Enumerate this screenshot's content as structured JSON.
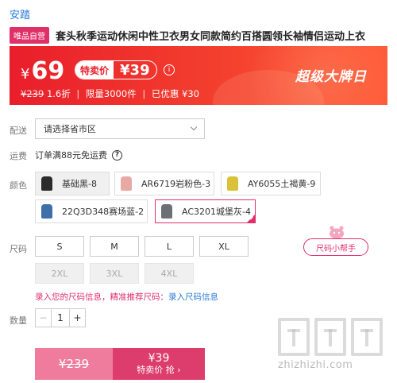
{
  "brand": "安踏",
  "product": {
    "tag": "唯品自营",
    "title": "套头秋季运动休闲中性卫衣男女同款简约百搭圆领长袖情侣运动上衣"
  },
  "banner": {
    "currency": "¥",
    "price": "69",
    "sale_label": "特卖价",
    "sale_price": "¥39",
    "info_icon": "i",
    "original_price": "¥239",
    "discount": "1.6折",
    "limit": "限量3000件",
    "saved": "已优惠 ¥30",
    "promo": "超级大牌日",
    "colors": {
      "start": "#e91e2b",
      "end": "#ff5a36"
    }
  },
  "labels": {
    "delivery": "配送",
    "shipping": "运费",
    "color": "颜色",
    "size": "尺码",
    "quantity": "数量"
  },
  "delivery": {
    "placeholder": "请选择省市区"
  },
  "shipping": {
    "text": "订单满88元免运费",
    "help_icon": "?"
  },
  "colors": [
    {
      "label": "基础黑-8",
      "swatch": "#2b2b2b",
      "disabled": true
    },
    {
      "label": "AR6719岩粉色-3",
      "swatch": "#e8a9a5",
      "disabled": false
    },
    {
      "label": "AY6055土褐黄-9",
      "swatch": "#d9c23a",
      "disabled": false
    },
    {
      "label": "22Q3D348赛场蓝-2",
      "swatch": "#3f6fa8",
      "disabled": false
    },
    {
      "label": "AC3201城堡灰-4",
      "swatch": "#6d6f75",
      "disabled": false,
      "selected": true
    }
  ],
  "sizes": [
    {
      "label": "S",
      "disabled": false
    },
    {
      "label": "M",
      "disabled": false
    },
    {
      "label": "L",
      "disabled": false
    },
    {
      "label": "XL",
      "disabled": false
    },
    {
      "label": "2XL",
      "disabled": true
    },
    {
      "label": "3XL",
      "disabled": true
    },
    {
      "label": "4XL",
      "disabled": true
    }
  ],
  "size_helper": "尺码小帮手",
  "size_info": {
    "text": "录入您的尺码信息，精准推荐尺码：",
    "link": "录入尺码信息"
  },
  "quantity": {
    "minus": "−",
    "value": "1",
    "plus": "+"
  },
  "buy": {
    "original_price": "¥239",
    "sale_price": "¥39",
    "action": "特卖价 抢 ›"
  },
  "watermark": "zhizhizhi.com",
  "accent": "#e0306a"
}
